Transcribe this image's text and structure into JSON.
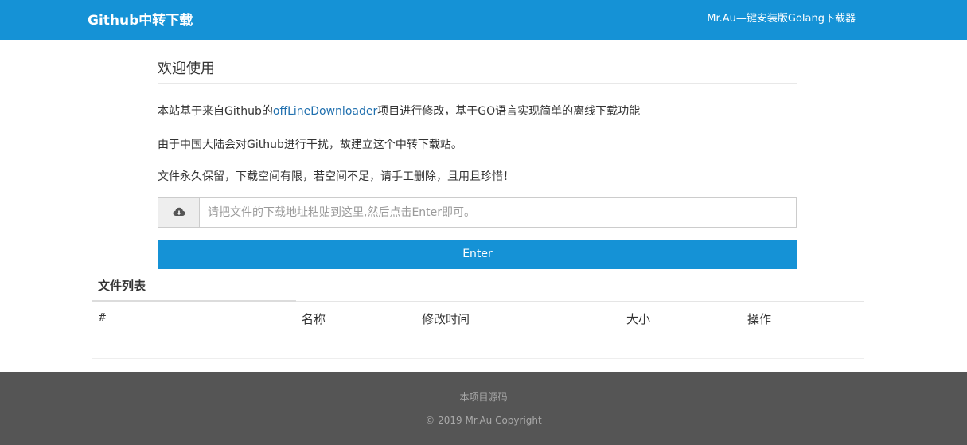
{
  "navbar": {
    "brand": "Github中转下载",
    "link": "Mr.Au—键安装版Golang下载器",
    "bg_color": "#1592d6"
  },
  "intro": {
    "heading": "欢迎使用",
    "line1_prefix": "本站基于来自Github的",
    "line1_link": "offLineDownloader",
    "line1_suffix": "项目进行修改，基于GO语言实现简单的离线下载功能",
    "line2": "由于中国大陆会对Github进行干扰，故建立这个中转下载站。",
    "line3": "文件永久保留，下载空间有限，若空间不足，请手工删除，且用且珍惜！"
  },
  "download_form": {
    "icon": "cloud-download-icon",
    "placeholder": "请把文件的下载地址粘贴到这里,然后点击Enter即可。",
    "value": "",
    "button_label": "Enter"
  },
  "file_list": {
    "title": "文件列表",
    "columns": [
      "#",
      "名称",
      "修改时间",
      "大小",
      "操作"
    ],
    "rows": []
  },
  "footer": {
    "source_link": "本项目源码",
    "copyright": "© 2019 Mr.Au Copyright",
    "bg_color": "#555555"
  }
}
